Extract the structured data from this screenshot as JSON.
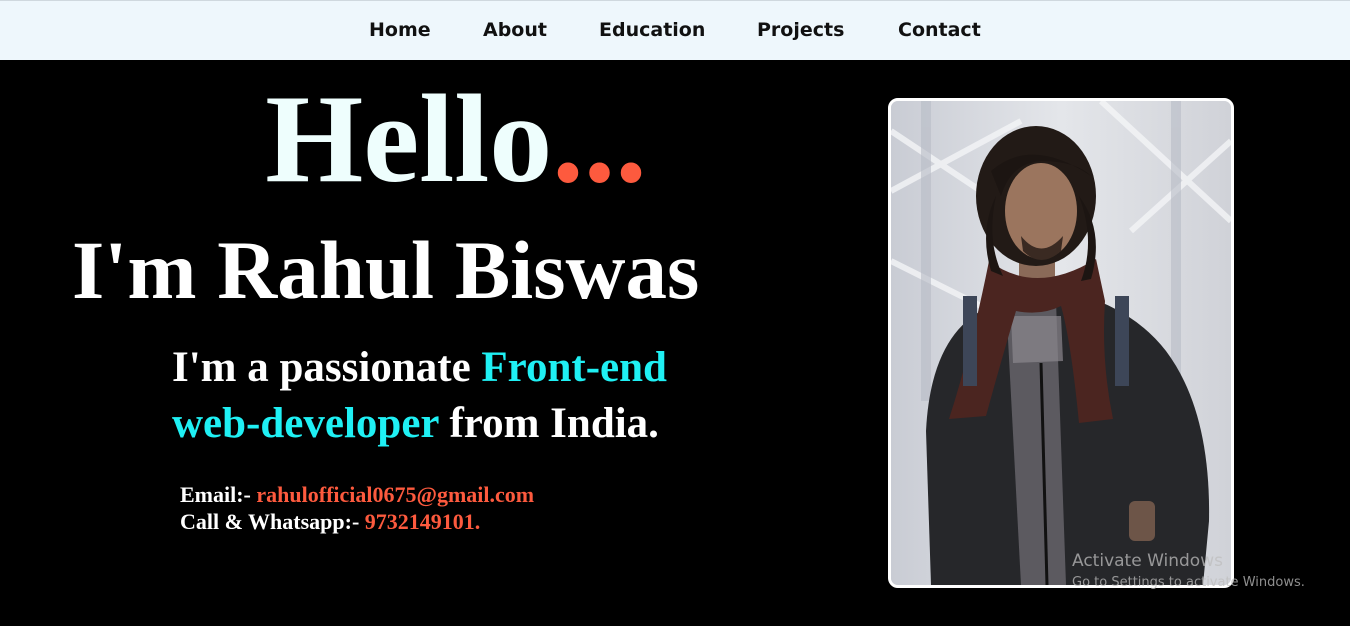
{
  "nav": {
    "items": [
      {
        "label": "Home"
      },
      {
        "label": "About"
      },
      {
        "label": "Education"
      },
      {
        "label": "Projects"
      },
      {
        "label": "Contact"
      }
    ]
  },
  "hero": {
    "greeting": "Hello",
    "greeting_dots": "...",
    "name_line": "I'm Rahul Biswas",
    "tagline_prefix": "I'm a passionate ",
    "tagline_accent": "Front-end web-developer",
    "tagline_suffix": " from India."
  },
  "contact": {
    "email_label": "Email:- ",
    "email_value": "rahulofficial0675@gmail.com",
    "phone_label": "Call & Whatsapp:- ",
    "phone_value": "9732149101."
  },
  "watermark": {
    "title": "Activate Windows",
    "subtitle": "Go to Settings to activate Windows."
  },
  "colors": {
    "accent_orange": "#fd5a3e",
    "accent_cyan": "#1ff0f4",
    "navbar_bg": "#eef7fc",
    "page_bg": "#000000"
  }
}
